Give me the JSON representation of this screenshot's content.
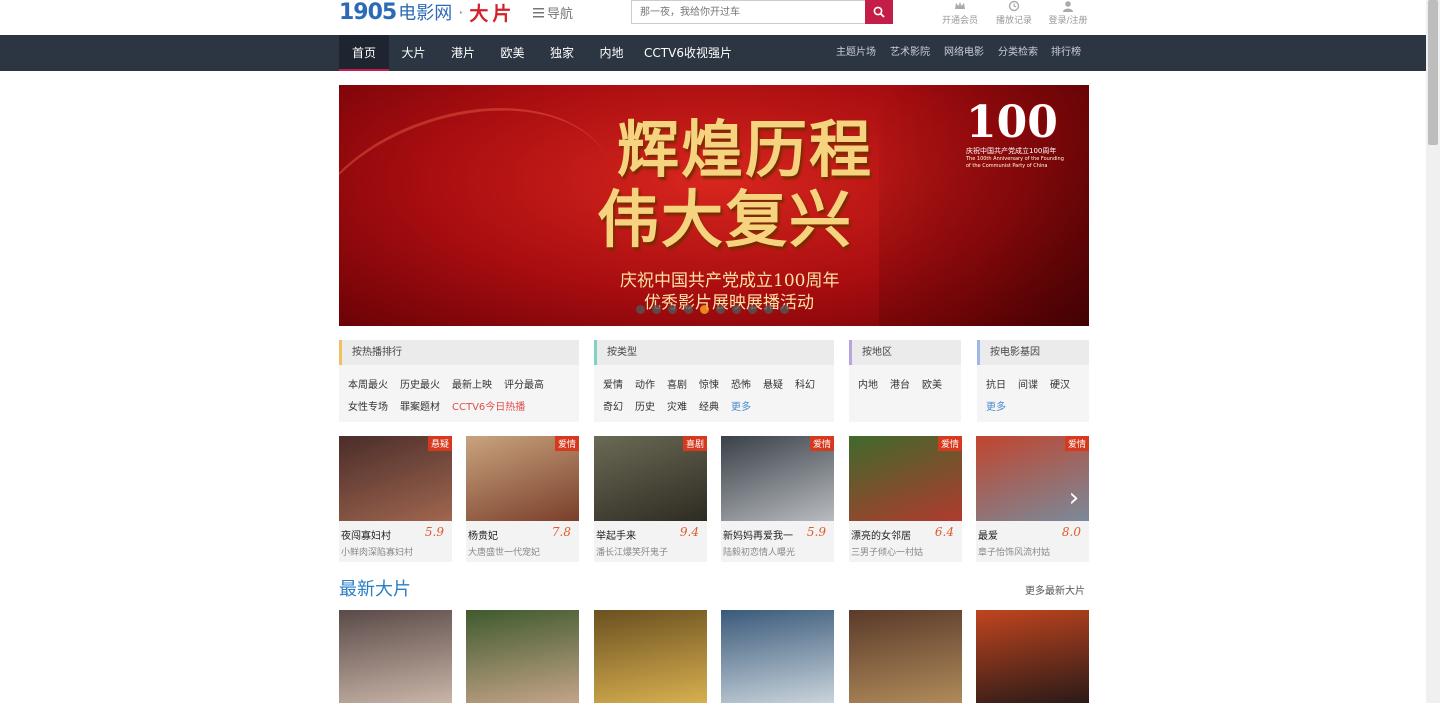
{
  "header": {
    "logo_num": "1905",
    "logo_text": "电影网",
    "logo_dot": "·",
    "logo_brand": "大片",
    "nav_toggle_label": "导航",
    "search_placeholder": "那一夜，我给你开过车",
    "user_links": [
      {
        "label": "开通会员",
        "icon": "crown-icon"
      },
      {
        "label": "播放记录",
        "icon": "history-icon"
      },
      {
        "label": "登录/注册",
        "icon": "user-icon"
      }
    ]
  },
  "main_nav": {
    "items": [
      "首页",
      "大片",
      "港片",
      "欧美",
      "独家",
      "内地",
      "CCTV6收视强片"
    ],
    "active": "首页",
    "right_items": [
      "主题片场",
      "艺术影院",
      "网络电影",
      "分类检索",
      "排行榜"
    ]
  },
  "banner": {
    "title_line1": "辉煌历程",
    "title_line2": "伟大复兴",
    "subtitle_line1": "庆祝中国共产党成立100周年",
    "subtitle_line2": "优秀影片展映展播活动",
    "badge_number": "100",
    "badge_caption": "庆祝中国共产党成立100周年",
    "badge_caption_en": "The 100th Anniversary of the Founding of the Communist Party of China",
    "dot_count": 10,
    "active_dot": 4
  },
  "filters": [
    {
      "title": "按热播排行",
      "accent": "#f0c060",
      "items": [
        {
          "t": "本周最火"
        },
        {
          "t": "历史最火"
        },
        {
          "t": "最新上映"
        },
        {
          "t": "评分最高"
        },
        {
          "t": "女性专场"
        },
        {
          "t": "罪案题材"
        },
        {
          "t": "CCTV6今日热播",
          "style": "hl"
        }
      ]
    },
    {
      "title": "按类型",
      "accent": "#7dd3c0",
      "items": [
        {
          "t": "爱情"
        },
        {
          "t": "动作"
        },
        {
          "t": "喜剧"
        },
        {
          "t": "惊悚"
        },
        {
          "t": "恐怖"
        },
        {
          "t": "悬疑"
        },
        {
          "t": "科幻"
        },
        {
          "t": "奇幻"
        },
        {
          "t": "历史"
        },
        {
          "t": "灾难"
        },
        {
          "t": "经典"
        },
        {
          "t": "更多",
          "style": "more"
        }
      ]
    },
    {
      "title": "按地区",
      "accent": "#b9a4e0",
      "items": [
        {
          "t": "内地"
        },
        {
          "t": "港台"
        },
        {
          "t": "欧美"
        }
      ]
    },
    {
      "title": "按电影基因",
      "accent": "#9fb7e8",
      "items": [
        {
          "t": "抗日"
        },
        {
          "t": "间谍"
        },
        {
          "t": "硬汉"
        },
        {
          "t": "更多",
          "style": "more"
        }
      ]
    }
  ],
  "hot_movies": [
    {
      "title": "夜闯寡妇村",
      "score": "5.9",
      "tag": "悬疑",
      "desc": "小鲜肉深陷寡妇村",
      "c1": "#4a2d2a",
      "c2": "#a0664f"
    },
    {
      "title": "杨贵妃",
      "score": "7.8",
      "tag": "爱情",
      "desc": "大唐盛世一代宠妃",
      "c1": "#c8a47e",
      "c2": "#7a3e2a"
    },
    {
      "title": "举起手来",
      "score": "9.4",
      "tag": "喜剧",
      "desc": "潘长江爆笑歼鬼子",
      "c1": "#6b6a55",
      "c2": "#2e2b22"
    },
    {
      "title": "新妈妈再爱我一",
      "score": "5.9",
      "tag": "爱情",
      "desc": "陆毅初恋情人曝光",
      "c1": "#3a4048",
      "c2": "#b8bcc0"
    },
    {
      "title": "漂亮的女邻居",
      "score": "6.4",
      "tag": "爱情",
      "desc": "三男子倾心一村姑",
      "c1": "#3f6a2c",
      "c2": "#b03a2e"
    },
    {
      "title": "最爱",
      "score": "8.0",
      "tag": "爱情",
      "desc": "章子怡饰风流村姑",
      "c1": "#c0452e",
      "c2": "#7a8a9a"
    }
  ],
  "latest": {
    "section_title": "最新大片",
    "more_label": "更多最新大片",
    "posters": [
      {
        "c1": "#5a4a48",
        "c2": "#c9b5a8"
      },
      {
        "c1": "#3f5a2e",
        "c2": "#c4a488"
      },
      {
        "c1": "#6b5020",
        "c2": "#d8b050"
      },
      {
        "c1": "#3a5a7a",
        "c2": "#c9d4dc"
      },
      {
        "c1": "#5a3a2a",
        "c2": "#b08a5a"
      },
      {
        "c1": "#c0451e",
        "c2": "#2a1a18"
      }
    ]
  }
}
